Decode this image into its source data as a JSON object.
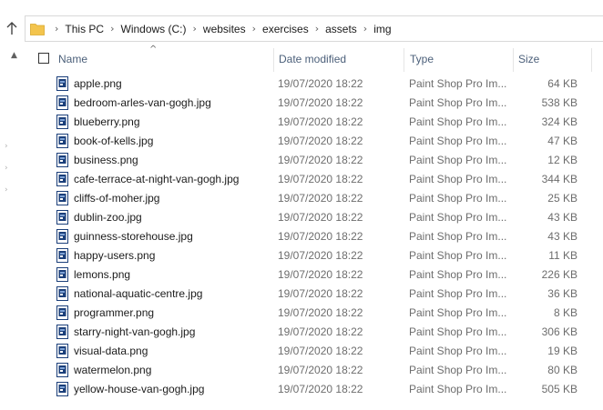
{
  "address_bar": {
    "breadcrumbs": [
      "This PC",
      "Windows (C:)",
      "websites",
      "exercises",
      "assets",
      "img"
    ]
  },
  "columns": {
    "name": "Name",
    "date_modified": "Date modified",
    "type": "Type",
    "size": "Size",
    "sort_indicator": "^"
  },
  "icons": {
    "up": "arrow-up-icon",
    "folder": "folder-icon",
    "separator": "chevron-right-icon",
    "file": "image-file-icon"
  },
  "colors": {
    "folder": "#f3c44d",
    "file_icon_blue": "#1b3f7a",
    "header_text": "#4c607a"
  },
  "files": [
    {
      "name": "apple.png",
      "date": "19/07/2020 18:22",
      "type": "Paint Shop Pro Im...",
      "size": "64 KB"
    },
    {
      "name": "bedroom-arles-van-gogh.jpg",
      "date": "19/07/2020 18:22",
      "type": "Paint Shop Pro Im...",
      "size": "538 KB"
    },
    {
      "name": "blueberry.png",
      "date": "19/07/2020 18:22",
      "type": "Paint Shop Pro Im...",
      "size": "324 KB"
    },
    {
      "name": "book-of-kells.jpg",
      "date": "19/07/2020 18:22",
      "type": "Paint Shop Pro Im...",
      "size": "47 KB"
    },
    {
      "name": "business.png",
      "date": "19/07/2020 18:22",
      "type": "Paint Shop Pro Im...",
      "size": "12 KB"
    },
    {
      "name": "cafe-terrace-at-night-van-gogh.jpg",
      "date": "19/07/2020 18:22",
      "type": "Paint Shop Pro Im...",
      "size": "344 KB"
    },
    {
      "name": "cliffs-of-moher.jpg",
      "date": "19/07/2020 18:22",
      "type": "Paint Shop Pro Im...",
      "size": "25 KB"
    },
    {
      "name": "dublin-zoo.jpg",
      "date": "19/07/2020 18:22",
      "type": "Paint Shop Pro Im...",
      "size": "43 KB"
    },
    {
      "name": "guinness-storehouse.jpg",
      "date": "19/07/2020 18:22",
      "type": "Paint Shop Pro Im...",
      "size": "43 KB"
    },
    {
      "name": "happy-users.png",
      "date": "19/07/2020 18:22",
      "type": "Paint Shop Pro Im...",
      "size": "11 KB"
    },
    {
      "name": "lemons.png",
      "date": "19/07/2020 18:22",
      "type": "Paint Shop Pro Im...",
      "size": "226 KB"
    },
    {
      "name": "national-aquatic-centre.jpg",
      "date": "19/07/2020 18:22",
      "type": "Paint Shop Pro Im...",
      "size": "36 KB"
    },
    {
      "name": "programmer.png",
      "date": "19/07/2020 18:22",
      "type": "Paint Shop Pro Im...",
      "size": "8 KB"
    },
    {
      "name": "starry-night-van-gogh.jpg",
      "date": "19/07/2020 18:22",
      "type": "Paint Shop Pro Im...",
      "size": "306 KB"
    },
    {
      "name": "visual-data.png",
      "date": "19/07/2020 18:22",
      "type": "Paint Shop Pro Im...",
      "size": "19 KB"
    },
    {
      "name": "watermelon.png",
      "date": "19/07/2020 18:22",
      "type": "Paint Shop Pro Im...",
      "size": "80 KB"
    },
    {
      "name": "yellow-house-van-gogh.jpg",
      "date": "19/07/2020 18:22",
      "type": "Paint Shop Pro Im...",
      "size": "505 KB"
    }
  ]
}
